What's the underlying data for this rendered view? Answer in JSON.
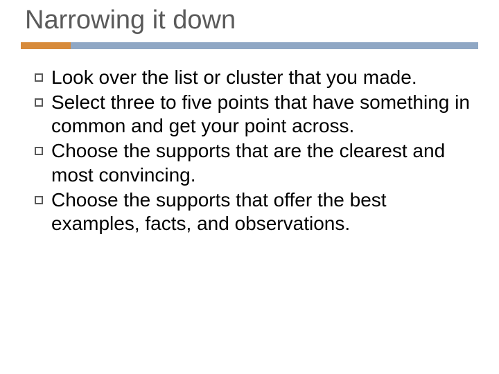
{
  "title": "Narrowing it down",
  "bullets": [
    "Look over the list or cluster that you made.",
    "Select three to five points that have something in common and get your point across.",
    "Choose the supports that are the clearest and most convincing.",
    "Choose the supports that offer the best examples, facts,  and observations."
  ],
  "colors": {
    "accent": "#d78a3a",
    "bar": "#8fa7c4",
    "title": "#5a5a5a"
  }
}
